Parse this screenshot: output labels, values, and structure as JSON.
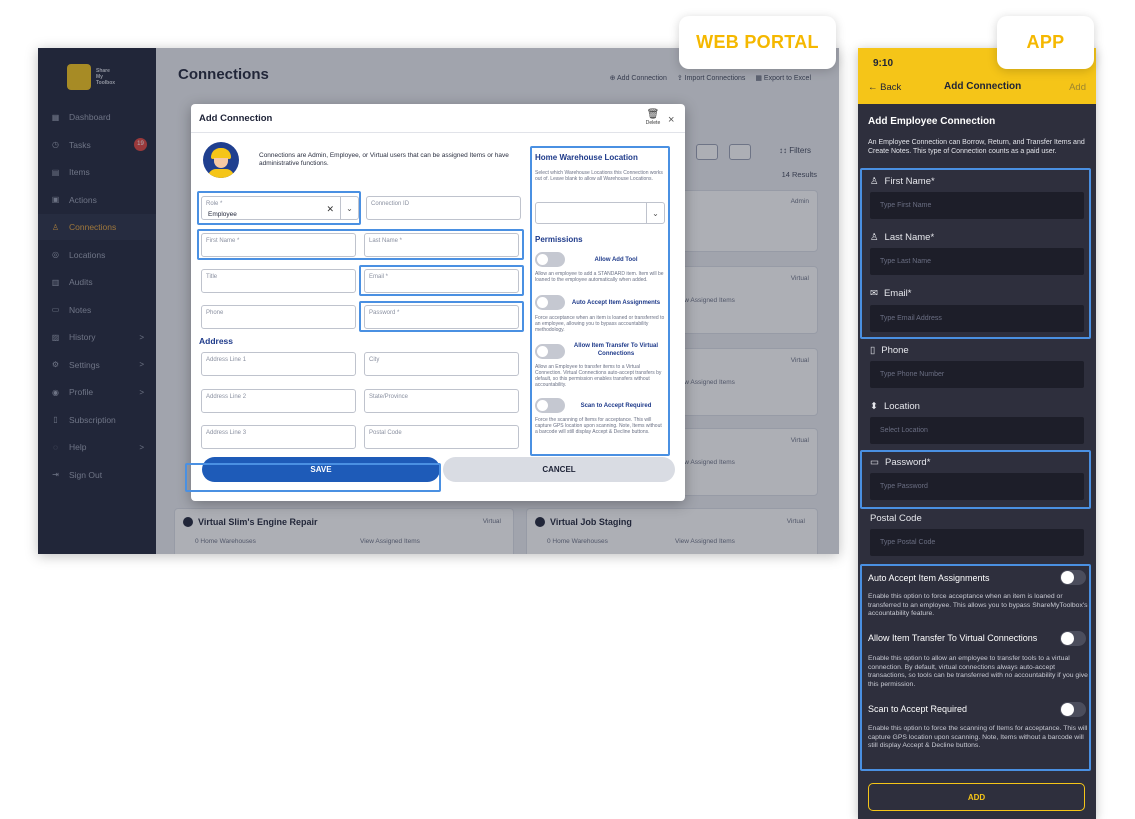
{
  "badges": {
    "web": "WEB PORTAL",
    "app": "APP"
  },
  "web": {
    "logo_text": [
      "Share",
      "My",
      "Toolbox"
    ],
    "nav": [
      {
        "label": "Dashboard",
        "icon": "dashboard-icon",
        "glyph": "▦"
      },
      {
        "label": "Tasks",
        "icon": "tasks-icon",
        "glyph": "◷",
        "badge": "19"
      },
      {
        "label": "Items",
        "icon": "items-icon",
        "glyph": "▤"
      },
      {
        "label": "Actions",
        "icon": "actions-icon",
        "glyph": "▣"
      },
      {
        "label": "Connections",
        "icon": "connections-icon",
        "glyph": "♙",
        "active": true
      },
      {
        "label": "Locations",
        "icon": "location-icon",
        "glyph": "◎"
      },
      {
        "label": "Audits",
        "icon": "audits-icon",
        "glyph": "▥"
      },
      {
        "label": "Notes",
        "icon": "notes-icon",
        "glyph": "▭"
      },
      {
        "label": "History",
        "icon": "history-icon",
        "glyph": "▨",
        "chevron": ">"
      },
      {
        "label": "Settings",
        "icon": "settings-icon",
        "glyph": "⚙",
        "chevron": ">"
      },
      {
        "label": "Profile",
        "icon": "profile-icon",
        "glyph": "◉",
        "chevron": ">"
      },
      {
        "label": "Subscription",
        "icon": "subscription-icon",
        "glyph": "▯"
      },
      {
        "label": "Help",
        "icon": "help-icon",
        "glyph": "◌",
        "chevron": ">"
      },
      {
        "label": "Sign Out",
        "icon": "signout-icon",
        "glyph": "⇥"
      }
    ],
    "page_title": "Connections",
    "actions": {
      "add": "⊕ Add Connection",
      "import": "⇪ Import Connections",
      "export": "▦ Export to Excel"
    },
    "filters": "↕↕ Filters",
    "results": "14 Results",
    "bg_cards": {
      "card_a": "Virtual Slim's Engine Repair",
      "card_b": "Virtual Job Staging",
      "warehouses": "0 Home Warehouses",
      "assigned": "View Assigned Items",
      "tag_virtual": "Virtual",
      "tag_admin": "Admin"
    },
    "modal": {
      "title": "Add Connection",
      "delete": "Delete",
      "close": "×",
      "intro": "Connections are Admin, Employee, or Virtual users that can be assigned Items or have administrative functions.",
      "role_label": "Role *",
      "role_value": "Employee",
      "connection_id": "Connection ID",
      "first_name": "First Name *",
      "last_name": "Last Name *",
      "title_field": "Title",
      "email": "Email *",
      "phone": "Phone",
      "password": "Password *",
      "address_heading": "Address",
      "address1": "Address Line 1",
      "city": "City",
      "address2": "Address Line 2",
      "state": "State/Province",
      "address3": "Address Line 3",
      "postal": "Postal Code",
      "warehouse_heading": "Home Warehouse Location",
      "warehouse_desc": "Select which Warehouse Locations this Connection works out of. Leave blank to allow all Warehouse Locations.",
      "permissions_heading": "Permissions",
      "perm1_label": "Allow Add Tool",
      "perm1_desc": "Allow an employee to add a STANDARD item. Item will be loaned to the employee automatically when added.",
      "perm2_label": "Auto Accept Item Assignments",
      "perm2_desc": "Force acceptance when an item is loaned or transferred to an employee, allowing you to bypass accountability methodology.",
      "perm3_label": "Allow Item Transfer To Virtual Connections",
      "perm3_desc": "Allow an Employee to transfer items to a Virtual Connection. Virtual Connections auto-accept transfers by default, so this permission enables transfers without accountability.",
      "perm4_label": "Scan to Accept Required",
      "perm4_desc": "Force the scanning of Items for acceptance. This will capture GPS location upon scanning. Note, Items without a barcode will still display Accept & Decline buttons.",
      "save": "SAVE",
      "cancel": "CANCEL"
    }
  },
  "app": {
    "time": "9:10",
    "back": "← Back",
    "title": "Add Connection",
    "add": "Add",
    "heading": "Add Employee Connection",
    "desc": "An Employee Connection can Borrow, Return, and Transfer Items and Create Notes. This type of Connection counts as a paid user.",
    "first_name": "First Name*",
    "first_ph": "Type First Name",
    "last_name": "Last Name*",
    "last_ph": "Type Last Name",
    "email": "Email*",
    "email_ph": "Type Email Address",
    "phone": "Phone",
    "phone_ph": "Type Phone Number",
    "location": "Location",
    "location_ph": "Select Location",
    "password": "Password*",
    "password_ph": "Type Password",
    "postal": "Postal Code",
    "postal_ph": "Type Postal Code",
    "opt1": "Auto Accept Item Assignments",
    "opt1_desc": "Enable this option to force acceptance when an item is loaned or transferred to an employee. This allows you to bypass ShareMyToolbox's accountability feature.",
    "opt2": "Allow Item Transfer To Virtual Connections",
    "opt2_desc": "Enable this option to allow an employee to transfer tools to a virtual connection. By default, virtual connections always auto-accept transactions, so tools can be transferred with no accountability if you give this permission.",
    "opt3": "Scan to Accept Required",
    "opt3_desc": "Enable this option to force the scanning of Items for acceptance. This will capture GPS location upon scanning. Note, Items without a barcode will still display Accept & Decline buttons.",
    "add_button": "ADD"
  }
}
